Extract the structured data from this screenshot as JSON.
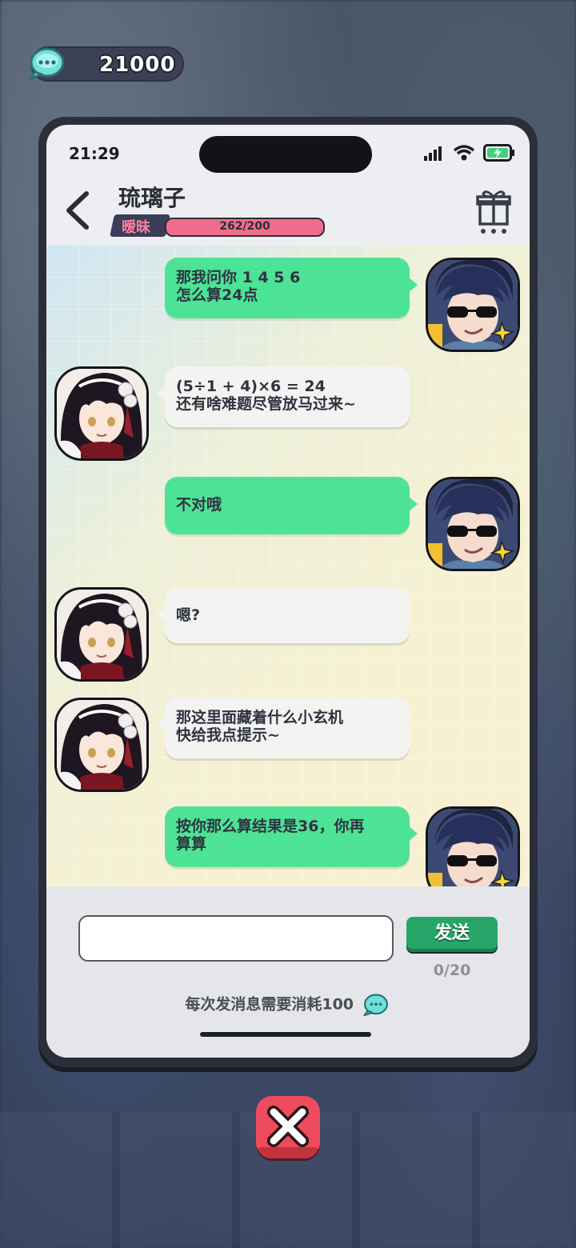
{
  "currency": {
    "value": "21000",
    "icon": "chat-coin-icon"
  },
  "status_bar": {
    "time": "21:29"
  },
  "header": {
    "contact_name": "琉璃子",
    "affinity_label": "暧昧",
    "affinity_text": "262/200",
    "affinity_fraction": 1.0
  },
  "messages": [
    {
      "side": "out",
      "text": "那我问你 1 4 5 6\n怎么算24点"
    },
    {
      "side": "in",
      "text": "(5÷1 + 4)×6 = 24\n还有啥难题尽管放马过来~"
    },
    {
      "side": "out",
      "text": "不对哦"
    },
    {
      "side": "in",
      "text": "嗯?"
    },
    {
      "side": "in",
      "text": "那这里面藏着什么小玄机\n快给我点提示~"
    },
    {
      "side": "out",
      "text": "按你那么算结果是36，你再\n算算"
    }
  ],
  "input": {
    "value": "",
    "placeholder": ""
  },
  "send_button": {
    "label": "发送"
  },
  "counter": "0/20",
  "cost_note": "每次发消息需要消耗100",
  "colors": {
    "outgoing": "#4de396",
    "incoming": "#f3f3f1",
    "send": "#28a66a",
    "close": "#ee4b5e"
  }
}
